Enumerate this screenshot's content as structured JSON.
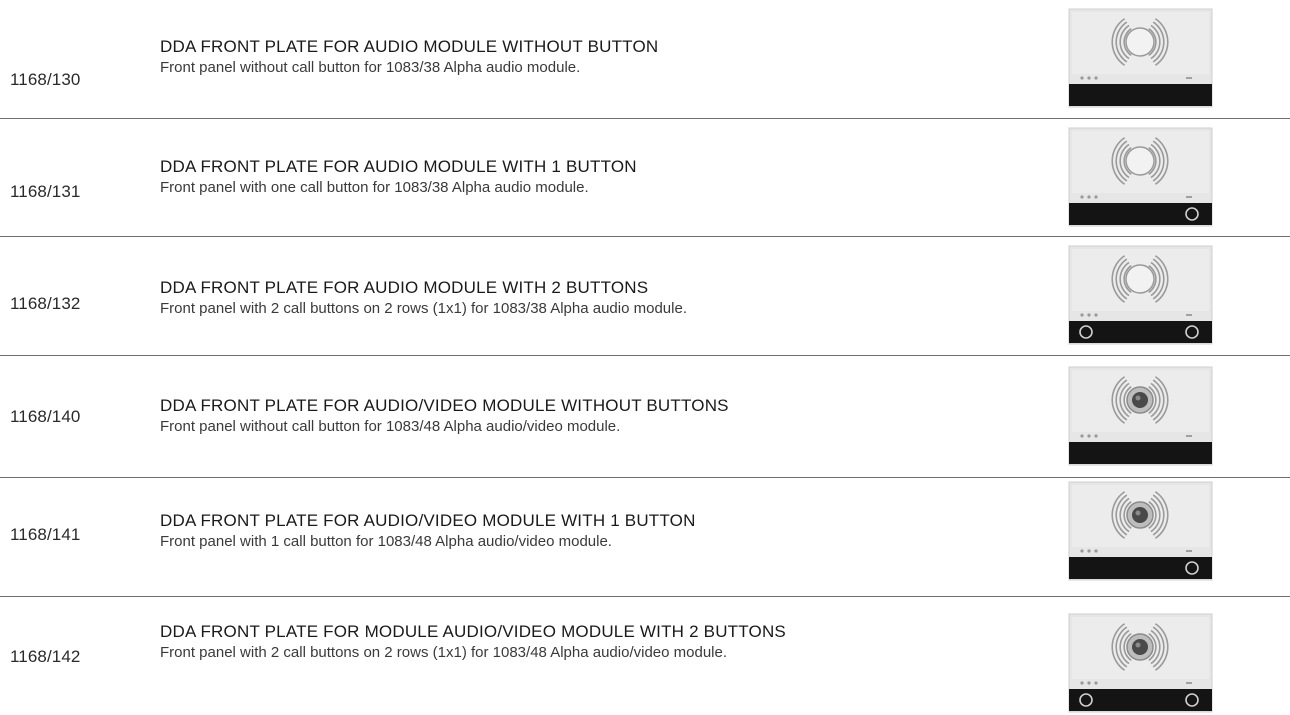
{
  "products": [
    {
      "code": "1168/130",
      "title": "DDA FRONT PLATE FOR AUDIO MODULE WITHOUT BUTTON",
      "description": "Front panel without call button for 1083/38 Alpha audio module.",
      "image": {
        "module": "audio",
        "buttons": 0
      }
    },
    {
      "code": "1168/131",
      "title": "DDA FRONT PLATE FOR AUDIO MODULE WITH 1 BUTTON",
      "description": "Front panel with one call button for 1083/38 Alpha audio module.",
      "image": {
        "module": "audio",
        "buttons": 1
      }
    },
    {
      "code": "1168/132",
      "title": "DDA FRONT PLATE FOR AUDIO MODULE WITH 2 BUTTONS",
      "description": "Front panel with 2 call buttons on 2 rows (1x1) for 1083/38 Alpha audio module.",
      "image": {
        "module": "audio",
        "buttons": 2
      }
    },
    {
      "code": "1168/140",
      "title": "DDA FRONT PLATE FOR AUDIO/VIDEO MODULE WITHOUT BUTTONS",
      "description": "Front panel without call button for 1083/48 Alpha audio/video module.",
      "image": {
        "module": "audio-video",
        "buttons": 0
      }
    },
    {
      "code": "1168/141",
      "title": "DDA FRONT PLATE FOR AUDIO/VIDEO MODULE WITH 1 BUTTON",
      "description": "Front panel with 1 call button for 1083/48 Alpha audio/video module.",
      "image": {
        "module": "audio-video",
        "buttons": 1
      }
    },
    {
      "code": "1168/142",
      "title": "DDA FRONT PLATE FOR MODULE AUDIO/VIDEO MODULE WITH 2 BUTTONS",
      "description": "Front panel with 2 call buttons on 2 rows (1x1) for 1083/48 Alpha audio/video module.",
      "image": {
        "module": "audio-video",
        "buttons": 2
      }
    }
  ]
}
